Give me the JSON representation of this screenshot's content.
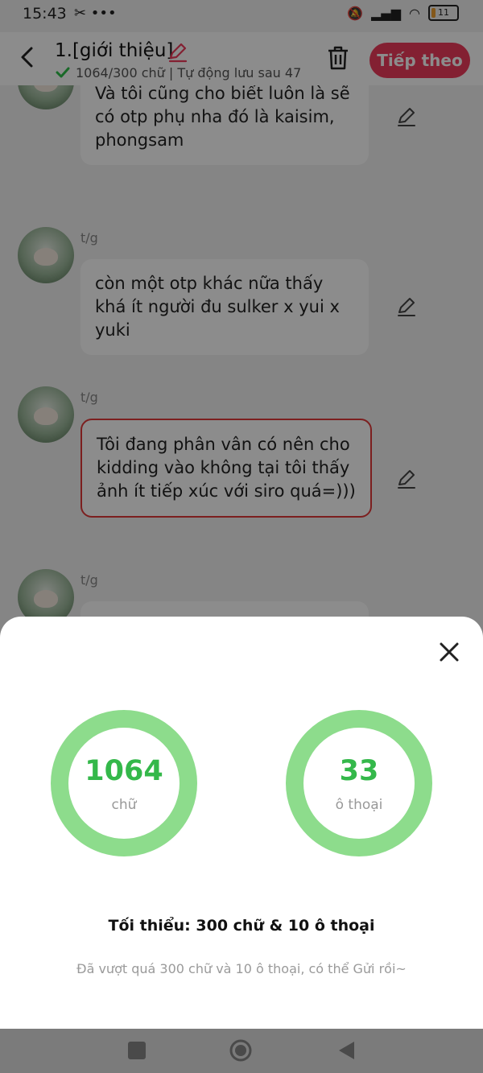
{
  "status_bar": {
    "time": "15:43",
    "battery": "11"
  },
  "header": {
    "title": "1.[giới thiệu]",
    "autosave_text": "1064/300 chữ | Tự động lưu sau 47",
    "next_label": "Tiếp theo"
  },
  "messages": [
    {
      "sender": "",
      "text": "Và tôi cũng cho biết luôn là sẽ có otp phụ nha đó là kaisim, phongsam"
    },
    {
      "sender": "t/g",
      "text": "còn một otp khác nữa thấy khá ít người đu sulker x yui x yuki"
    },
    {
      "sender": "t/g",
      "text": "Tôi đang phân vân có nên cho kidding vào không tại tôi thấy ảnh ít tiếp xúc với siro quá=)))"
    },
    {
      "sender": "t/g",
      "text": ""
    }
  ],
  "stats": {
    "words_value": "1064",
    "words_unit": "chữ",
    "dialogs_value": "33",
    "dialogs_unit": "ô thoại",
    "requirement": "Tối thiểu: 300 chữ & 10 ô thoại",
    "hint": "Đã vượt quá 300 chữ và 10 ô thoại, có thể Gửi rồi~"
  },
  "colors": {
    "accent": "#ee3b5b",
    "ring": "#8ddc8c",
    "value_green": "#34b84a"
  },
  "icons": [
    "back-icon",
    "edit-icon",
    "check-icon",
    "trash-icon",
    "pen-icon",
    "close-icon"
  ]
}
